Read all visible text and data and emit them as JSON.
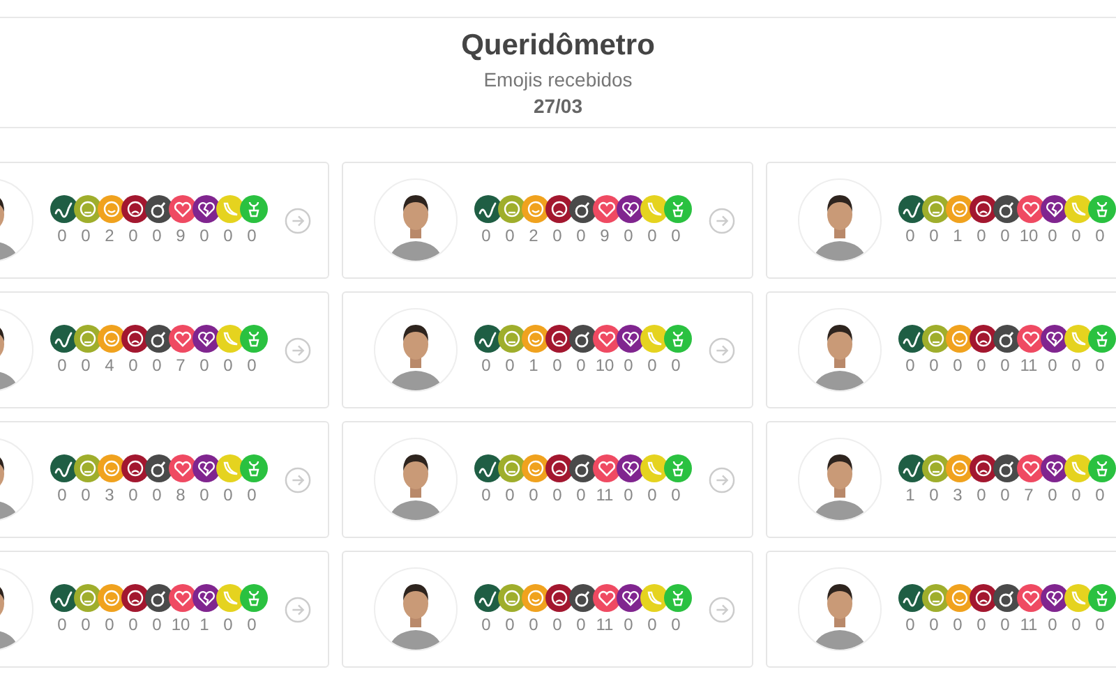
{
  "header": {
    "title": "Queridômetro",
    "subtitle": "Emojis recebidos",
    "date": "27/03"
  },
  "emoji_kinds": [
    {
      "kind": "snake",
      "color": "#1f5e44"
    },
    {
      "kind": "sick",
      "color": "#9fae2c"
    },
    {
      "kind": "smile",
      "color": "#f0a21e"
    },
    {
      "kind": "angry",
      "color": "#a3172f"
    },
    {
      "kind": "bomb",
      "color": "#4a4a4a"
    },
    {
      "kind": "heart",
      "color": "#ef4a62"
    },
    {
      "kind": "broken-heart",
      "color": "#80258f"
    },
    {
      "kind": "banana",
      "color": "#e5d31f"
    },
    {
      "kind": "plant",
      "color": "#2ac140"
    }
  ],
  "cards": [
    {
      "counts": [
        "0",
        "0",
        "2",
        "0",
        "0",
        "9",
        "0",
        "0",
        "0"
      ]
    },
    {
      "counts": [
        "0",
        "0",
        "2",
        "0",
        "0",
        "9",
        "0",
        "0",
        "0"
      ]
    },
    {
      "counts": [
        "0",
        "0",
        "1",
        "0",
        "0",
        "10",
        "0",
        "0",
        "0"
      ]
    },
    {
      "counts": [
        "0",
        "0",
        "4",
        "0",
        "0",
        "7",
        "0",
        "0",
        "0"
      ]
    },
    {
      "counts": [
        "0",
        "0",
        "1",
        "0",
        "0",
        "10",
        "0",
        "0",
        "0"
      ]
    },
    {
      "counts": [
        "0",
        "0",
        "0",
        "0",
        "0",
        "11",
        "0",
        "0",
        "0"
      ]
    },
    {
      "counts": [
        "0",
        "0",
        "3",
        "0",
        "0",
        "8",
        "0",
        "0",
        "0"
      ]
    },
    {
      "counts": [
        "0",
        "0",
        "0",
        "0",
        "0",
        "11",
        "0",
        "0",
        "0"
      ]
    },
    {
      "counts": [
        "1",
        "0",
        "3",
        "0",
        "0",
        "7",
        "0",
        "0",
        "0"
      ]
    },
    {
      "counts": [
        "0",
        "0",
        "0",
        "0",
        "0",
        "10",
        "1",
        "0",
        "0"
      ]
    },
    {
      "counts": [
        "0",
        "0",
        "0",
        "0",
        "0",
        "11",
        "0",
        "0",
        "0"
      ]
    },
    {
      "counts": [
        "0",
        "0",
        "0",
        "0",
        "0",
        "11",
        "0",
        "0",
        "0"
      ]
    }
  ]
}
